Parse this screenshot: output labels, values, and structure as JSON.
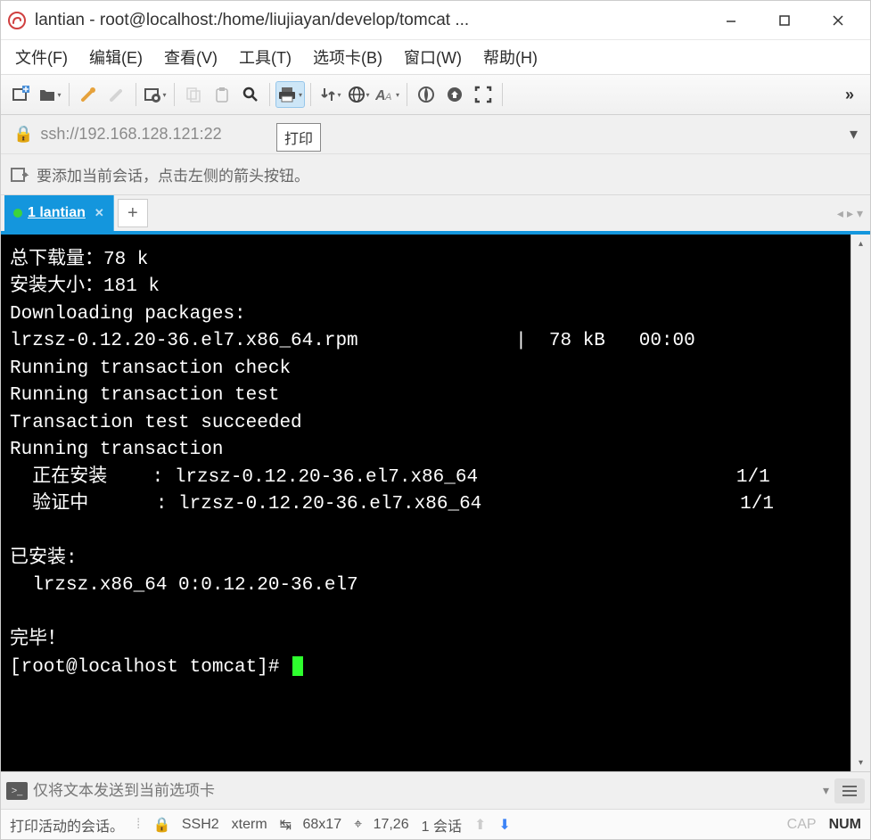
{
  "window": {
    "title": "lantian - root@localhost:/home/liujiayan/develop/tomcat ..."
  },
  "menu": {
    "file": "文件(F)",
    "edit": "编辑(E)",
    "view": "查看(V)",
    "tools": "工具(T)",
    "options": "选项卡(B)",
    "window": "窗口(W)",
    "help": "帮助(H)"
  },
  "tooltip": {
    "print": "打印"
  },
  "address": {
    "url": "ssh://192.168.128.121:22"
  },
  "hint": {
    "text": "要添加当前会话，点击左侧的箭头按钮。"
  },
  "tabs": {
    "active_label": "1 lantian"
  },
  "terminal": {
    "lines": [
      "总下载量：78 k",
      "安装大小：181 k",
      "Downloading packages:",
      "lrzsz-0.12.20-36.el7.x86_64.rpm              |  78 kB   00:00",
      "Running transaction check",
      "Running transaction test",
      "Transaction test succeeded",
      "Running transaction",
      "  正在安装    : lrzsz-0.12.20-36.el7.x86_64                       1/1",
      "  验证中      : lrzsz-0.12.20-36.el7.x86_64                       1/1",
      "",
      "已安装:",
      "  lrzsz.x86_64 0:0.12.20-36.el7",
      "",
      "完毕！"
    ],
    "prompt": "[root@localhost tomcat]# "
  },
  "sendbar": {
    "placeholder": "仅将文本发送到当前选项卡"
  },
  "status": {
    "left": "打印活动的会话。",
    "proto_icon": "🔒",
    "proto": "SSH2",
    "term": "xterm",
    "size": "68x17",
    "pos": "17,26",
    "sessions": "1 会话",
    "cap": "CAP",
    "num": "NUM"
  }
}
